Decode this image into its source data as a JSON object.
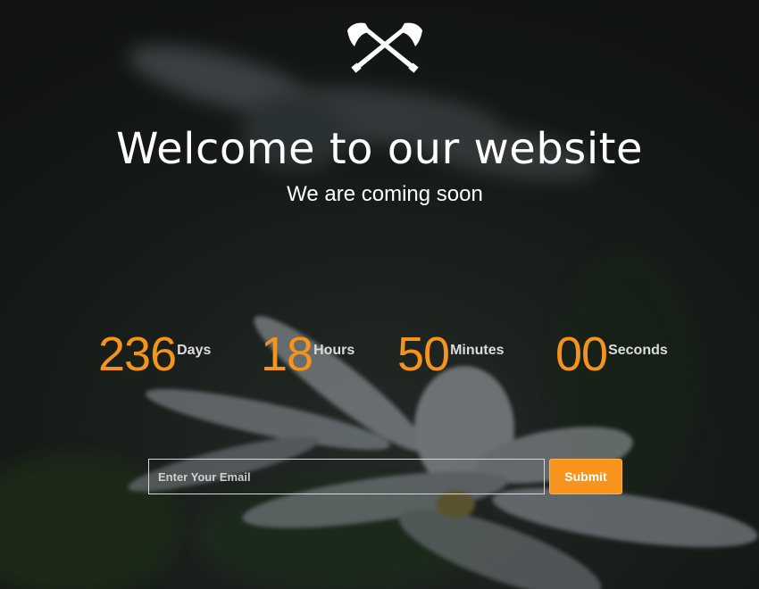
{
  "logo": {
    "icon": "crossed-axes-icon"
  },
  "hero": {
    "title": "Welcome to our website",
    "subtitle": "We are coming soon"
  },
  "countdown": {
    "days": {
      "value": "236",
      "label": "Days"
    },
    "hours": {
      "value": "18",
      "label": "Hours"
    },
    "minutes": {
      "value": "50",
      "label": "Minutes"
    },
    "seconds": {
      "value": "00",
      "label": "Seconds"
    }
  },
  "subscribe": {
    "email_placeholder": "Enter Your Email",
    "submit_label": "Submit"
  },
  "colors": {
    "accent": "#f7941d",
    "text": "#ffffff",
    "overlay": "#151a17"
  }
}
